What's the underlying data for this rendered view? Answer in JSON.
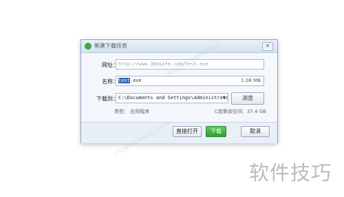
{
  "dialog": {
    "title": "新建下载任务",
    "close_glyph": "✕",
    "url_label": "网址：",
    "url_value": "http://www.360safe.com/test.exe",
    "name_label": "名称：",
    "name_selected": "test",
    "name_ext": ".exe",
    "file_size": "1.08 MB",
    "save_label": "下载到：",
    "save_path": "C:\\Documents and Settings\\Administrator\\",
    "path_arrow": "▼",
    "browse_label": "浏览",
    "type_text": "类型： 应用程序",
    "free_space": "C盘剩余空间：37.4 GB",
    "open_label": "直接打开",
    "download_label": "下载",
    "cancel_label": "取消"
  },
  "watermark": {
    "text": "软件技巧",
    "faint_text": "jingyan.baidu.com"
  },
  "colors": {
    "accent_green": "#3cab3c",
    "dialog_border": "#8aa6c9",
    "selection": "#2b5fad"
  }
}
